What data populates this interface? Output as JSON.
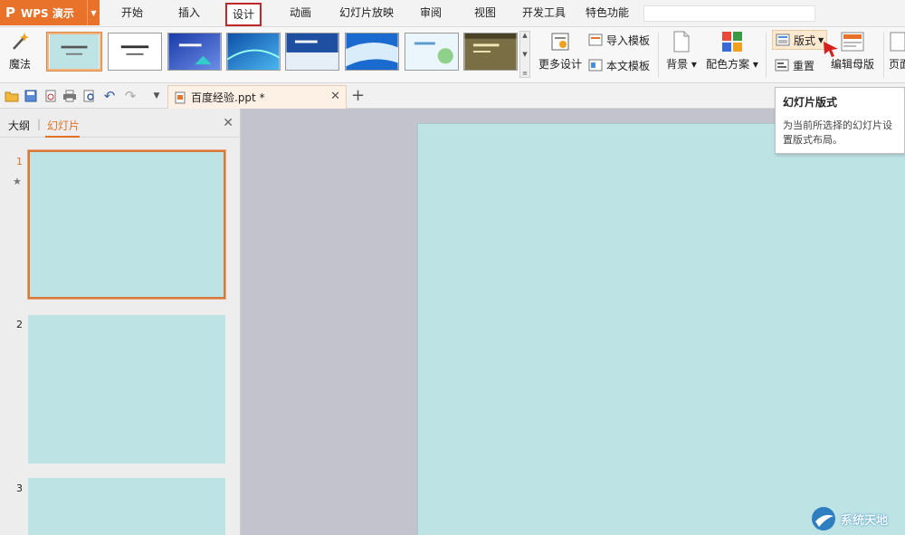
{
  "app": {
    "name": "WPS 演示",
    "accent_color": "#e8722a"
  },
  "menu_tabs": [
    {
      "label": "开始"
    },
    {
      "label": "插入"
    },
    {
      "label": "设计",
      "active": true
    },
    {
      "label": "动画"
    },
    {
      "label": "幻灯片放映"
    },
    {
      "label": "审阅"
    },
    {
      "label": "视图"
    },
    {
      "label": "开发工具"
    },
    {
      "label": "特色功能"
    }
  ],
  "ribbon": {
    "magic_label": "魔法",
    "more_design_label": "更多设计",
    "import_template_label": "导入模板",
    "this_template_label": "本文模板",
    "background_label": "背景",
    "color_scheme_label": "配色方案",
    "layout_label": "版式",
    "reset_label": "重置",
    "edit_master_label": "编辑母版",
    "page_label": "页面"
  },
  "document": {
    "tab_title": "百度经验.ppt *"
  },
  "left_panel": {
    "outline_tab": "大纲",
    "slides_tab": "幻灯片",
    "slides": [
      {
        "number": "1"
      },
      {
        "number": "2"
      },
      {
        "number": "3"
      }
    ]
  },
  "tooltip": {
    "title": "幻灯片版式",
    "description": "为当前所选择的幻灯片设置版式布局。"
  },
  "colors": {
    "slide_background": "#bde3e4",
    "active_tab_border": "#c0282a",
    "selection_border": "#d57a3c"
  },
  "watermark": {
    "text": "系统天地"
  }
}
